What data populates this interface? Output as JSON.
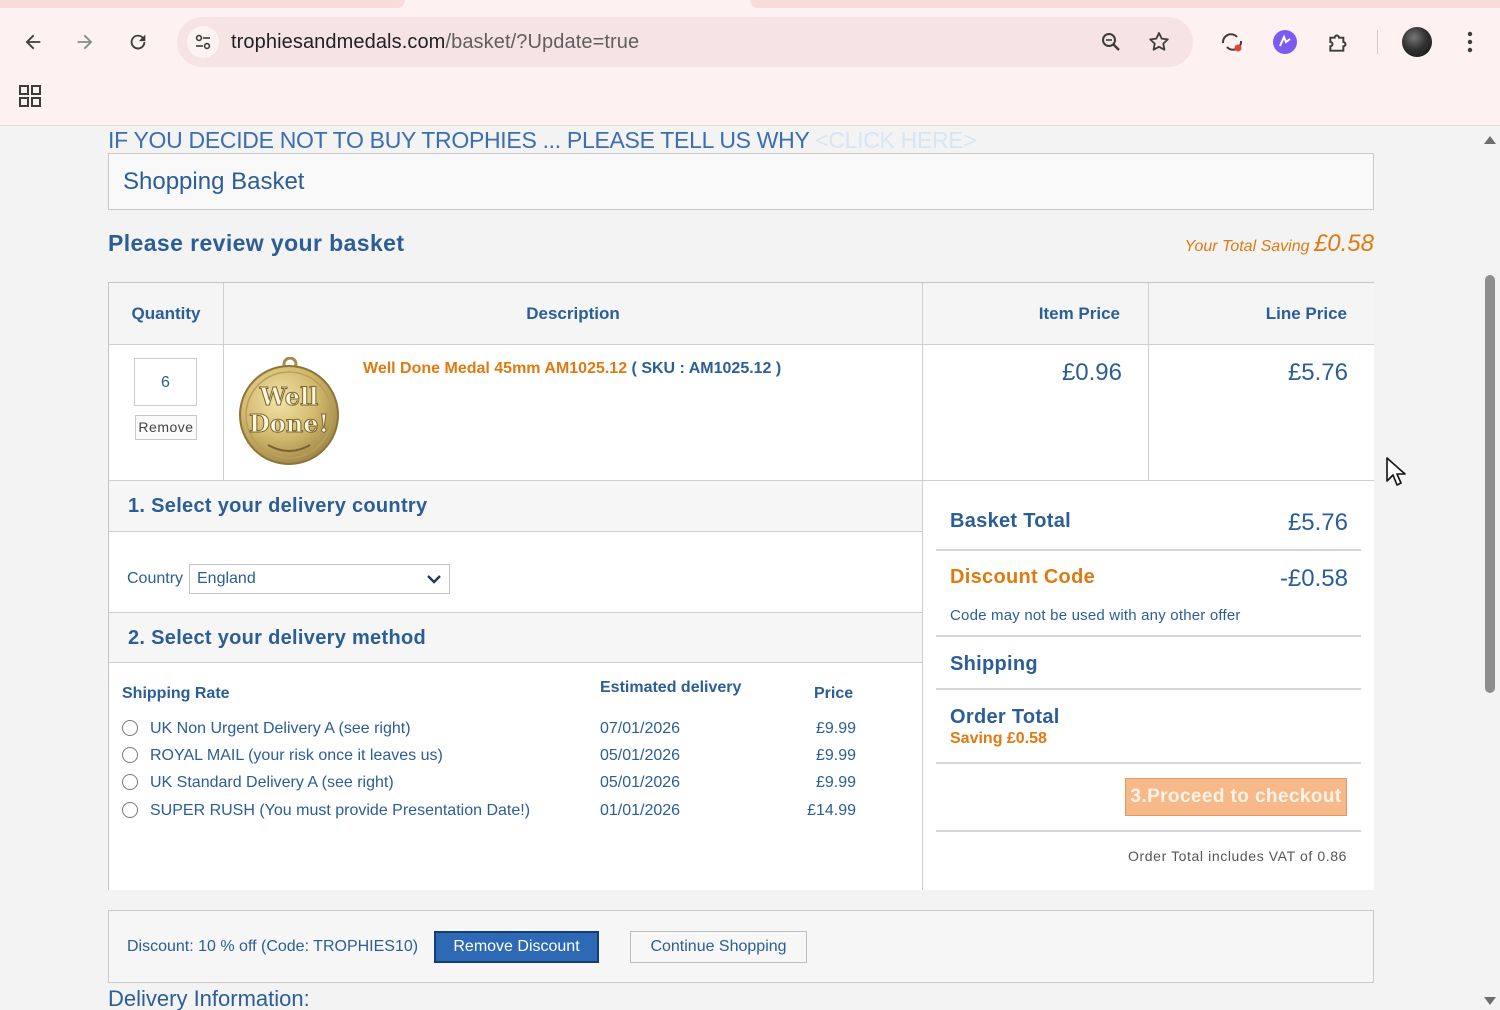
{
  "browser": {
    "url_host": "trophiesandmedals.com",
    "url_path": "/basket/?Update=true",
    "icons": [
      "back-arrow-icon",
      "forward-arrow-icon",
      "reload-icon",
      "site-info-icon",
      "zoom-icon",
      "bookmark-star-icon",
      "account-sync-icon",
      "extension-purple-icon",
      "extensions-puzzle-icon",
      "profile-avatar",
      "menu-kebab-icon",
      "apps-grid-icon"
    ]
  },
  "banner": {
    "text": "IF YOU DECIDE NOT TO BUY TROPHIES ... PLEASE TELL US WHY ",
    "link": "<CLICK HERE>"
  },
  "section_title": "Shopping Basket",
  "review_title": "Please review your basket",
  "saving": {
    "label": "Your Total Saving ",
    "amount": "£0.58"
  },
  "table": {
    "headers": {
      "quantity": "Quantity",
      "description": "Description",
      "item_price": "Item Price",
      "line_price": "Line Price"
    },
    "item": {
      "quantity": "6",
      "remove_label": "Remove",
      "name": "Well Done Medal 45mm AM1025.12",
      "sku": " ( SKU : AM1025.12 )",
      "medal_text_1": "Well",
      "medal_text_2": "Done!",
      "item_price": "£0.96",
      "line_price": "£5.76"
    }
  },
  "delivery": {
    "step1_num": "1.",
    "step1_title": " Select your delivery country",
    "country_label": "Country",
    "country_value": "England",
    "step2_num": "2.",
    "step2_title": " Select your delivery method",
    "col_rate": "Shipping Rate",
    "col_estimated": "Estimated delivery",
    "col_price": "Price",
    "options": [
      {
        "name": "UK Non Urgent Delivery A (see right)",
        "date": "07/01/2026",
        "price": "£9.99"
      },
      {
        "name": "ROYAL MAIL (your risk once it leaves us)",
        "date": "05/01/2026",
        "price": "£9.99"
      },
      {
        "name": "UK Standard Delivery A (see right)",
        "date": "05/01/2026",
        "price": "£9.99"
      },
      {
        "name": "SUPER RUSH (You must provide Presentation Date!)",
        "date": "01/01/2026",
        "price": "£14.99"
      }
    ]
  },
  "summary": {
    "basket_total_label": "Basket Total",
    "basket_total": "£5.76",
    "discount_label": "Discount Code",
    "discount_value": "-£0.58",
    "discount_note": "Code may not be used with any other offer",
    "shipping_label": "Shipping",
    "order_total_label": "Order Total",
    "order_saving": "Saving £0.58",
    "checkout_label": "3.Proceed to checkout",
    "vat_note": "Order Total includes VAT of 0.86"
  },
  "discount_bar": {
    "text": "Discount:  10 % off (Code: TROPHIES10)",
    "remove_label": "Remove Discount",
    "continue_label": "Continue Shopping"
  },
  "delivery_info_title": "Delivery Information:",
  "colors": {
    "accent_blue": "#2b5d97",
    "accent_orange": "#e07a10",
    "chrome_bg": "#fdf1f1"
  }
}
